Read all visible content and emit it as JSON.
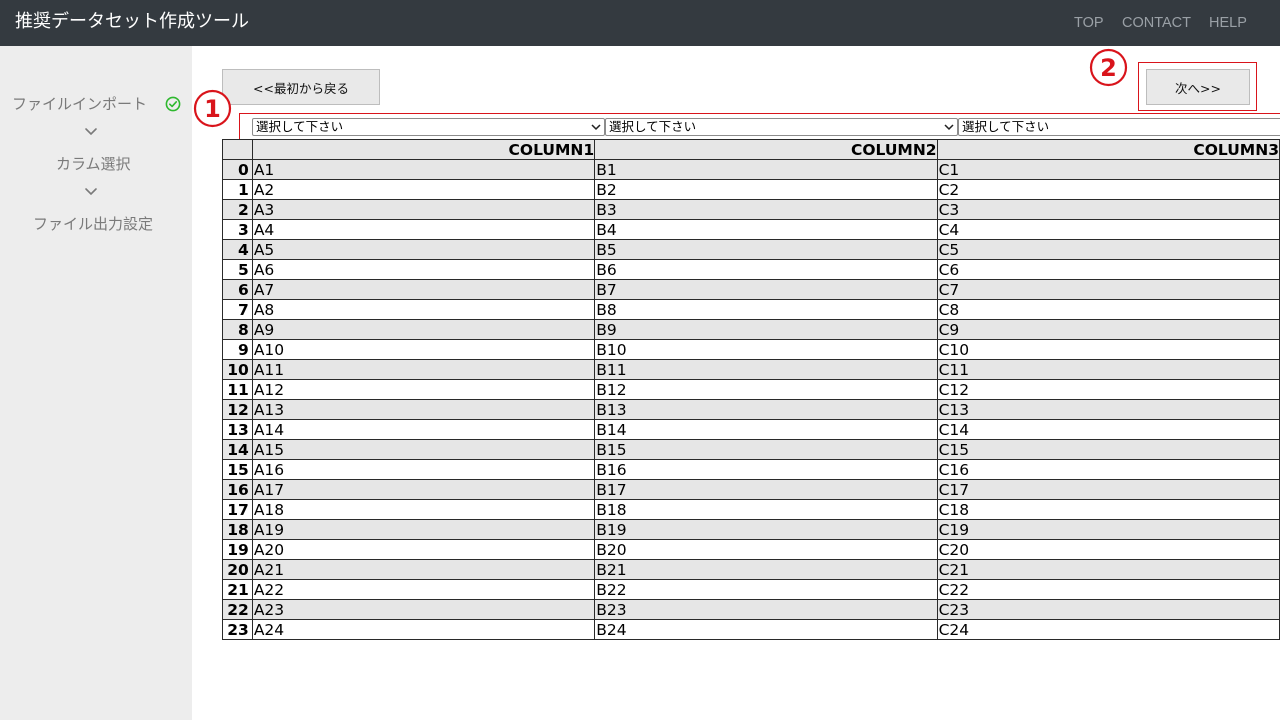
{
  "header": {
    "title": "推奨データセット作成ツール",
    "nav": {
      "top": "TOP",
      "contact": "CONTACT",
      "help": "HELP"
    }
  },
  "sidebar": {
    "steps": [
      {
        "label": "ファイルインポート",
        "completed": true
      },
      {
        "label": "カラム選択",
        "completed": false
      },
      {
        "label": "ファイル出力設定",
        "completed": false
      }
    ]
  },
  "buttons": {
    "back": "<<最初から戻る",
    "next": "次へ>>"
  },
  "annotations": {
    "marker1": "①",
    "marker2": "②",
    "color": "#d9141b"
  },
  "selects": [
    {
      "value": "選択して下さい"
    },
    {
      "value": "選択して下さい"
    },
    {
      "value": "選択して下さい"
    }
  ],
  "table": {
    "columns": [
      "COLUMN1",
      "COLUMN2",
      "COLUMN3"
    ],
    "rows": [
      {
        "index": "0",
        "cells": [
          "A1",
          "B1",
          "C1"
        ]
      },
      {
        "index": "1",
        "cells": [
          "A2",
          "B2",
          "C2"
        ]
      },
      {
        "index": "2",
        "cells": [
          "A3",
          "B3",
          "C3"
        ]
      },
      {
        "index": "3",
        "cells": [
          "A4",
          "B4",
          "C4"
        ]
      },
      {
        "index": "4",
        "cells": [
          "A5",
          "B5",
          "C5"
        ]
      },
      {
        "index": "5",
        "cells": [
          "A6",
          "B6",
          "C6"
        ]
      },
      {
        "index": "6",
        "cells": [
          "A7",
          "B7",
          "C7"
        ]
      },
      {
        "index": "7",
        "cells": [
          "A8",
          "B8",
          "C8"
        ]
      },
      {
        "index": "8",
        "cells": [
          "A9",
          "B9",
          "C9"
        ]
      },
      {
        "index": "9",
        "cells": [
          "A10",
          "B10",
          "C10"
        ]
      },
      {
        "index": "10",
        "cells": [
          "A11",
          "B11",
          "C11"
        ]
      },
      {
        "index": "11",
        "cells": [
          "A12",
          "B12",
          "C12"
        ]
      },
      {
        "index": "12",
        "cells": [
          "A13",
          "B13",
          "C13"
        ]
      },
      {
        "index": "13",
        "cells": [
          "A14",
          "B14",
          "C14"
        ]
      },
      {
        "index": "14",
        "cells": [
          "A15",
          "B15",
          "C15"
        ]
      },
      {
        "index": "15",
        "cells": [
          "A16",
          "B16",
          "C16"
        ]
      },
      {
        "index": "16",
        "cells": [
          "A17",
          "B17",
          "C17"
        ]
      },
      {
        "index": "17",
        "cells": [
          "A18",
          "B18",
          "C18"
        ]
      },
      {
        "index": "18",
        "cells": [
          "A19",
          "B19",
          "C19"
        ]
      },
      {
        "index": "19",
        "cells": [
          "A20",
          "B20",
          "C20"
        ]
      },
      {
        "index": "20",
        "cells": [
          "A21",
          "B21",
          "C21"
        ]
      },
      {
        "index": "21",
        "cells": [
          "A22",
          "B22",
          "C22"
        ]
      },
      {
        "index": "22",
        "cells": [
          "A23",
          "B23",
          "C23"
        ]
      },
      {
        "index": "23",
        "cells": [
          "A24",
          "B24",
          "C24"
        ]
      }
    ]
  }
}
